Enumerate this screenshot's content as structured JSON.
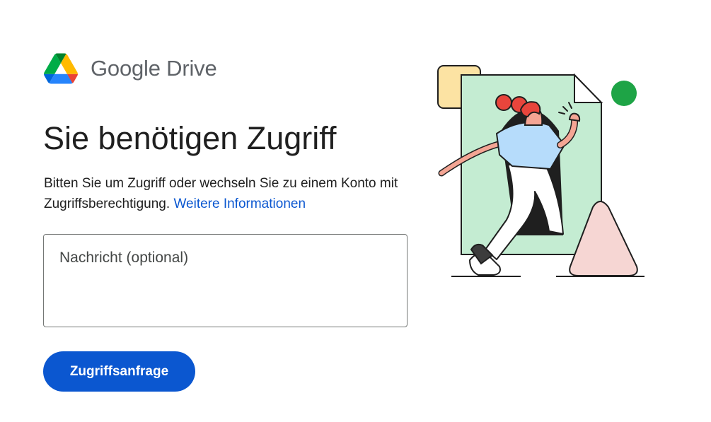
{
  "brand": {
    "logo_icon": "google-drive-logo",
    "name": "Google Drive"
  },
  "main": {
    "title": "Sie benötigen Zugriff",
    "description": "Bitten Sie um Zugriff oder wechseln Sie zu einem Konto mit Zugriffsberechtigung.",
    "learn_more_link": "Weitere Informationen",
    "message_placeholder": "Nachricht (optional)",
    "request_button_label": "Zugriffsanfrage"
  },
  "illustration": {
    "icon": "person-entering-document-illustration"
  },
  "colors": {
    "accent": "#0b57d0",
    "link": "#0b57d0",
    "title_text": "#1f1f1f",
    "brand_text": "#5f6368",
    "doc_green": "#c4ecd2",
    "circle_green": "#1ea446",
    "triangle_pink": "#f6d6d3",
    "square_yellow": "#fce3a3",
    "hair_red": "#e8453c",
    "shirt_blue": "#b6dcfb"
  }
}
